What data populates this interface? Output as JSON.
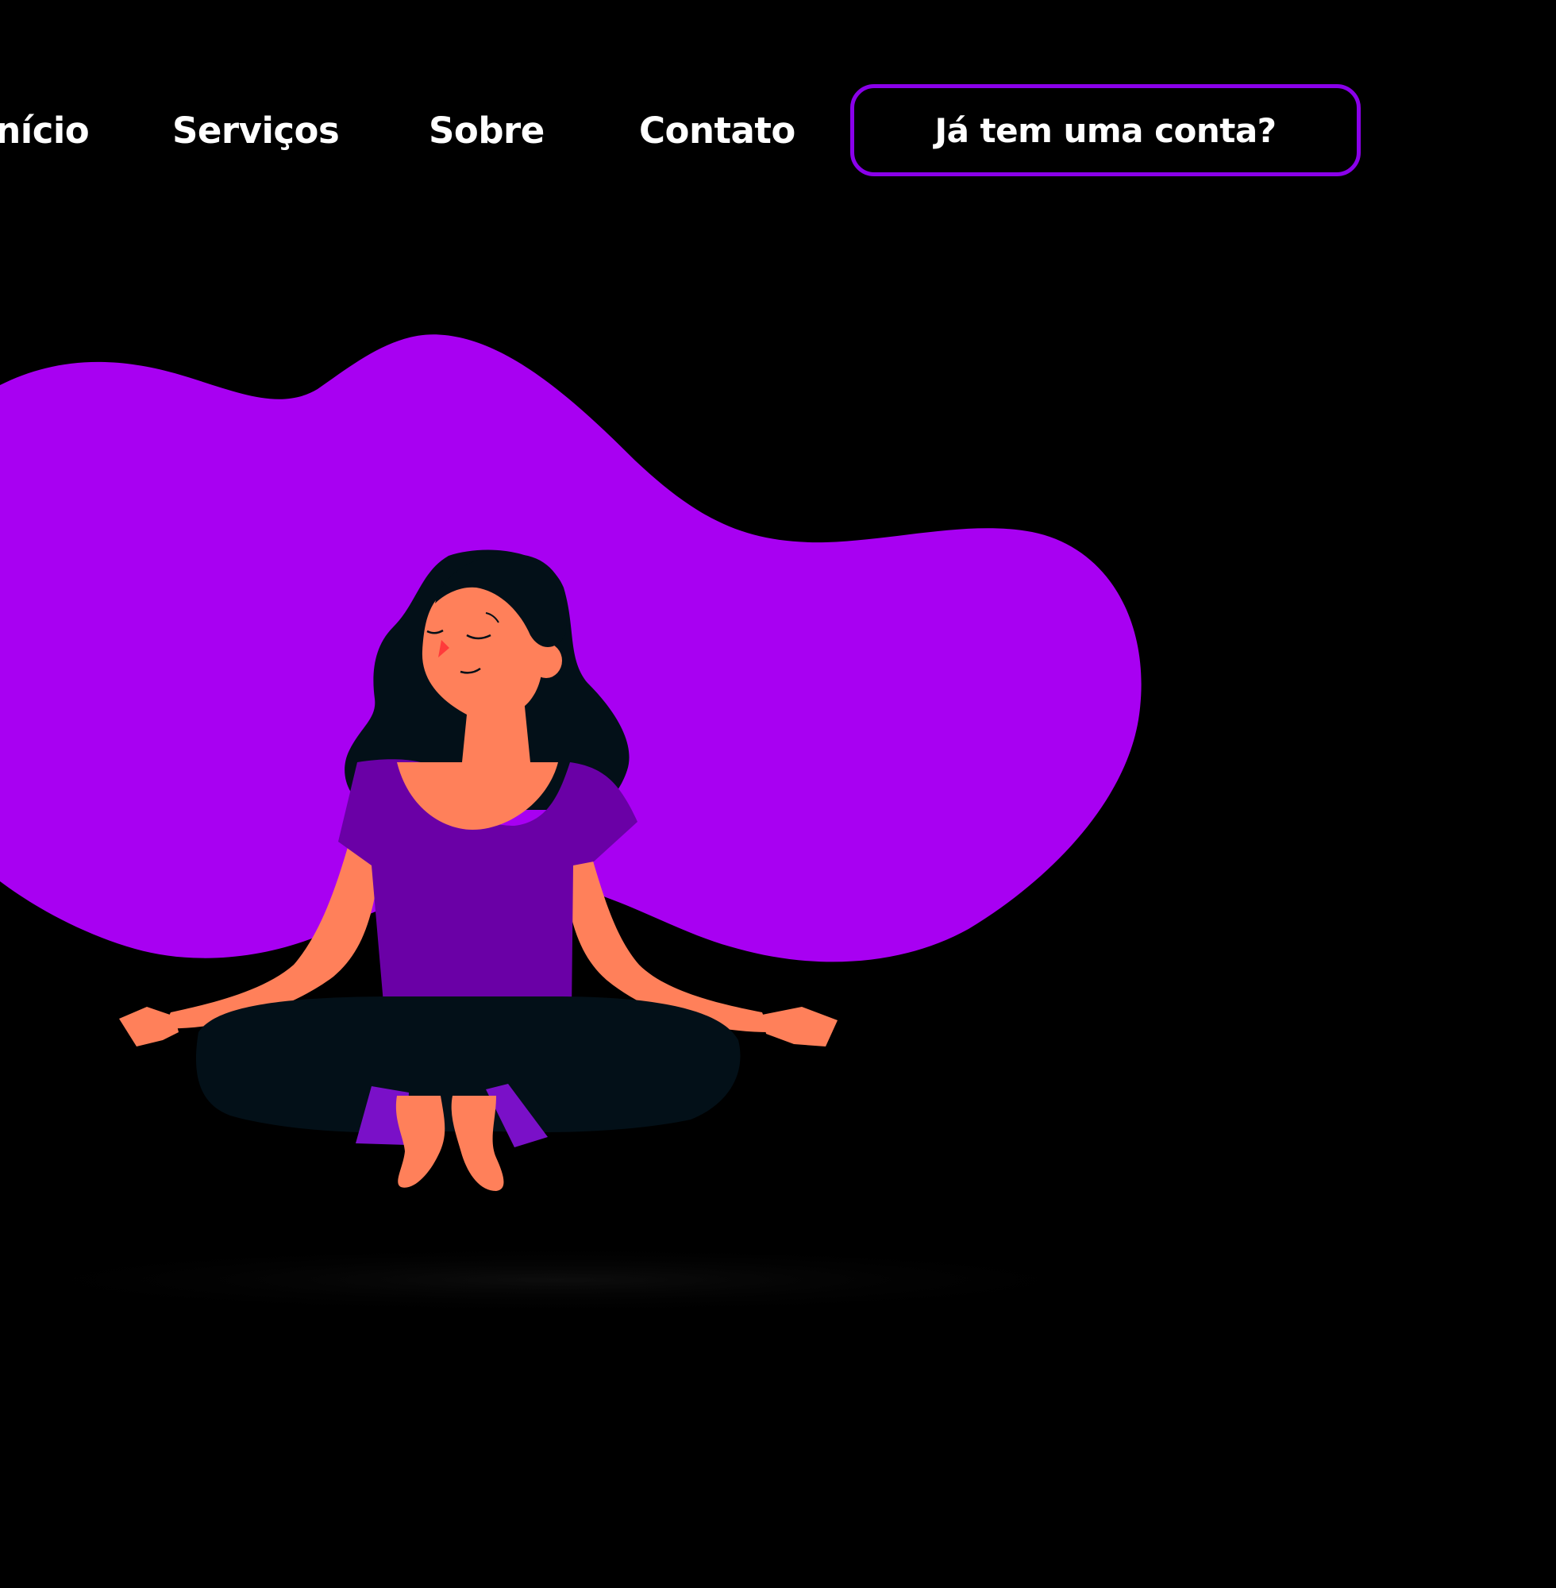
{
  "nav": {
    "links": [
      {
        "label": "Início"
      },
      {
        "label": "Serviços"
      },
      {
        "label": "Sobre"
      },
      {
        "label": "Contato"
      }
    ],
    "account_button": "Já tem uma conta?"
  },
  "hero": {
    "illustration": "woman-meditating-illustration"
  },
  "colors": {
    "background": "#000000",
    "accent": "#a800f2",
    "button_border": "#8a00ea",
    "skin": "#ff805a",
    "shirt": "#6a00a6",
    "hair_pants": "#031018",
    "text": "#ffffff"
  }
}
